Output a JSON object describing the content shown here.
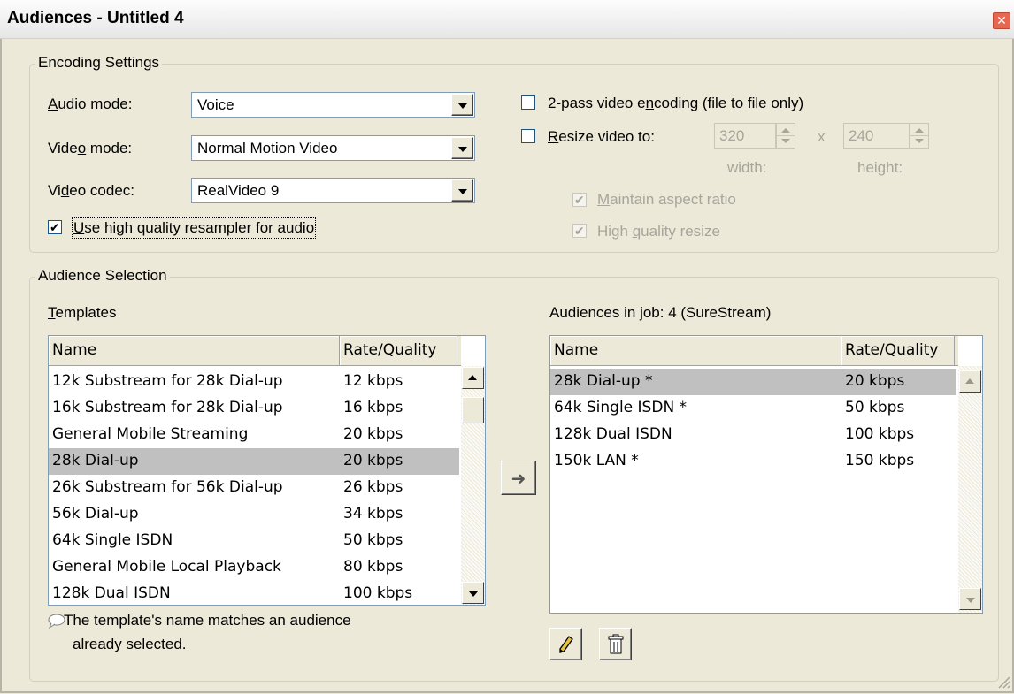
{
  "window": {
    "title": "Audiences - Untitled 4",
    "close_glyph": "✕"
  },
  "encoding": {
    "group_title": "Encoding Settings",
    "audio_mode": {
      "label_pre": "",
      "label_access": "A",
      "label_post": "udio mode:",
      "value": "Voice"
    },
    "video_mode": {
      "label_pre": "Vide",
      "label_access": "o",
      "label_post": " mode:",
      "value": "Normal Motion Video"
    },
    "video_codec": {
      "label_pre": "Vi",
      "label_access": "d",
      "label_post": "eo codec:",
      "value": "RealVideo 9"
    },
    "hq_resampler": {
      "checked": true,
      "label_pre": "",
      "label_access": "U",
      "label_post": "se high quality resampler for audio"
    },
    "two_pass": {
      "checked": false,
      "label_pre": "2-pass video e",
      "label_access": "n",
      "label_post": "coding (file to file only)"
    },
    "resize": {
      "checked": false,
      "label_pre": "",
      "label_access": "R",
      "label_post": "esize video to:"
    },
    "width_value": "320",
    "height_value": "240",
    "x_sep": "x",
    "width_label": "width:",
    "height_label": "height:",
    "maintain_aspect": {
      "checked": true,
      "label_pre": "",
      "label_access": "M",
      "label_post": "aintain aspect ratio"
    },
    "hq_resize": {
      "checked": true,
      "label_pre": "High ",
      "label_access": "q",
      "label_post": "uality resize"
    }
  },
  "audience": {
    "group_title": "Audience Selection",
    "templates_label_access": "T",
    "templates_label_post": "emplates",
    "templates_columns": [
      "Name",
      "Rate/Quality"
    ],
    "templates": [
      {
        "name": "12k Substream for 28k Dial-up",
        "rate": "12 kbps"
      },
      {
        "name": "16k Substream for 28k Dial-up",
        "rate": "16 kbps"
      },
      {
        "name": "General Mobile Streaming",
        "rate": "20 kbps"
      },
      {
        "name": "28k Dial-up",
        "rate": "20 kbps",
        "selected": true
      },
      {
        "name": "26k Substream for 56k Dial-up",
        "rate": "26 kbps"
      },
      {
        "name": "56k Dial-up",
        "rate": "34 kbps"
      },
      {
        "name": "64k Single ISDN",
        "rate": "50 kbps"
      },
      {
        "name": "General Mobile Local Playback",
        "rate": "80 kbps"
      },
      {
        "name": "128k Dual ISDN",
        "rate": "100 kbps"
      }
    ],
    "add_button_glyph": "➜",
    "in_job_label": "Audiences in job: 4  (SureStream)",
    "job_columns": [
      "Name",
      "Rate/Quality"
    ],
    "job_audiences": [
      {
        "name": "28k Dial-up *",
        "rate": "20 kbps",
        "selected": true
      },
      {
        "name": "64k Single ISDN *",
        "rate": "50 kbps"
      },
      {
        "name": "128k Dual ISDN",
        "rate": "100 kbps"
      },
      {
        "name": "150k LAN *",
        "rate": "150 kbps"
      }
    ],
    "note_line1": "The template's name matches an audience",
    "note_line2": "already selected.",
    "edit_icon": "pencil-icon",
    "delete_icon": "trash-icon"
  }
}
